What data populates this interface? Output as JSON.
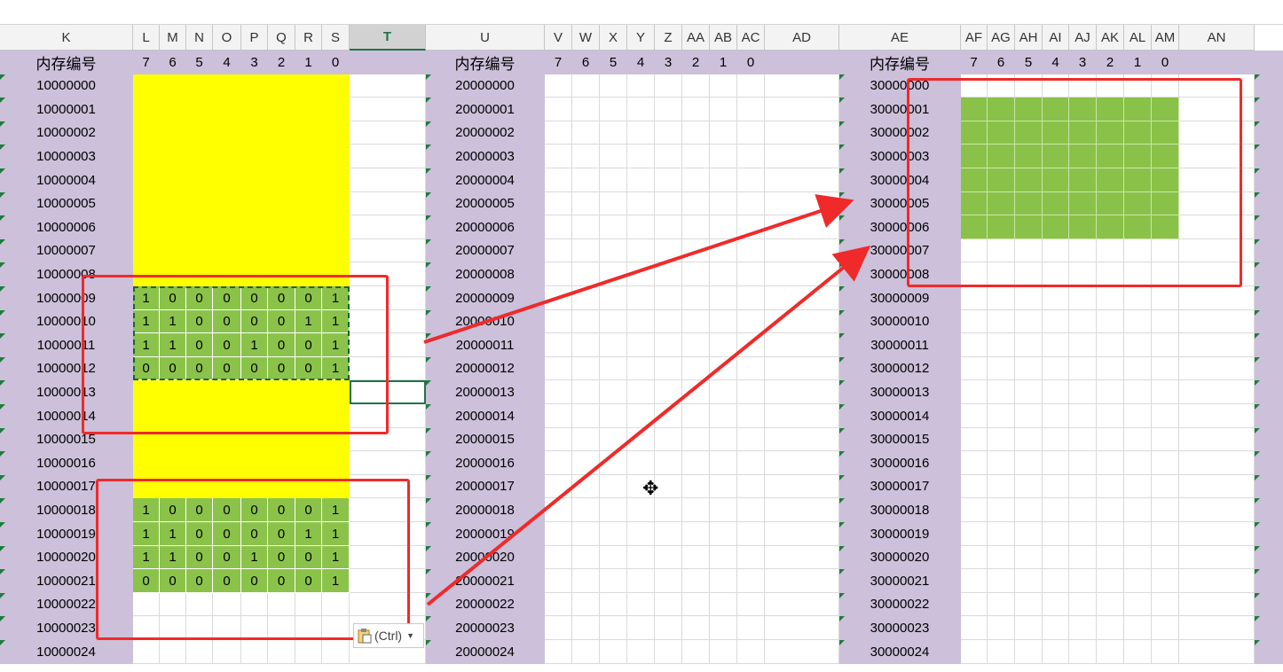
{
  "columns": [
    "K",
    "L",
    "M",
    "N",
    "O",
    "P",
    "Q",
    "R",
    "S",
    "T",
    "U",
    "V",
    "W",
    "X",
    "Y",
    "Z",
    "AA",
    "AB",
    "AC",
    "AD",
    "AE",
    "AF",
    "AG",
    "AH",
    "AI",
    "AJ",
    "AK",
    "AL",
    "AM",
    "AN"
  ],
  "selected_column": "T",
  "header_label": "内存编号",
  "bit_labels": [
    "7",
    "6",
    "5",
    "4",
    "3",
    "2",
    "1",
    "0"
  ],
  "rows_k": [
    "10000000",
    "10000001",
    "10000002",
    "10000003",
    "10000004",
    "10000005",
    "10000006",
    "10000007",
    "10000008",
    "10000009",
    "10000010",
    "10000011",
    "10000012",
    "10000013",
    "10000014",
    "10000015",
    "10000016",
    "10000017",
    "10000018",
    "10000019",
    "10000020",
    "10000021",
    "10000022",
    "10000023",
    "10000024"
  ],
  "rows_u": [
    "20000000",
    "20000001",
    "20000002",
    "20000003",
    "20000004",
    "20000005",
    "20000006",
    "20000007",
    "20000008",
    "20000009",
    "20000010",
    "20000011",
    "20000012",
    "20000013",
    "20000014",
    "20000015",
    "20000016",
    "20000017",
    "20000018",
    "20000019",
    "20000020",
    "20000021",
    "20000022",
    "20000023",
    "20000024"
  ],
  "rows_ae": [
    "30000000",
    "30000001",
    "30000002",
    "30000003",
    "30000004",
    "30000005",
    "30000006",
    "30000007",
    "30000008",
    "30000009",
    "30000010",
    "30000011",
    "30000012",
    "30000013",
    "30000014",
    "30000015",
    "30000016",
    "30000017",
    "30000018",
    "30000019",
    "30000020",
    "30000021",
    "30000022",
    "30000023",
    "30000024"
  ],
  "bits_block_a": [
    [
      "1",
      "0",
      "0",
      "0",
      "0",
      "0",
      "0",
      "1"
    ],
    [
      "1",
      "1",
      "0",
      "0",
      "0",
      "0",
      "1",
      "1"
    ],
    [
      "1",
      "1",
      "0",
      "0",
      "1",
      "0",
      "0",
      "1"
    ],
    [
      "0",
      "0",
      "0",
      "0",
      "0",
      "0",
      "0",
      "1"
    ]
  ],
  "bits_block_b": [
    [
      "1",
      "0",
      "0",
      "0",
      "0",
      "0",
      "0",
      "1"
    ],
    [
      "1",
      "1",
      "0",
      "0",
      "0",
      "0",
      "1",
      "1"
    ],
    [
      "1",
      "1",
      "0",
      "0",
      "1",
      "0",
      "0",
      "1"
    ],
    [
      "0",
      "0",
      "0",
      "0",
      "0",
      "0",
      "0",
      "1"
    ]
  ],
  "paste_options_label": "(Ctrl)",
  "paste_icon": "clipboard-icon",
  "cursor_icon": "move-cursor-icon",
  "colors": {
    "id_fill": "#ccc0da",
    "yellow": "#ffff00",
    "green": "#8bc34a",
    "annotation_red": "#f02a2a",
    "excel_green": "#217346"
  }
}
